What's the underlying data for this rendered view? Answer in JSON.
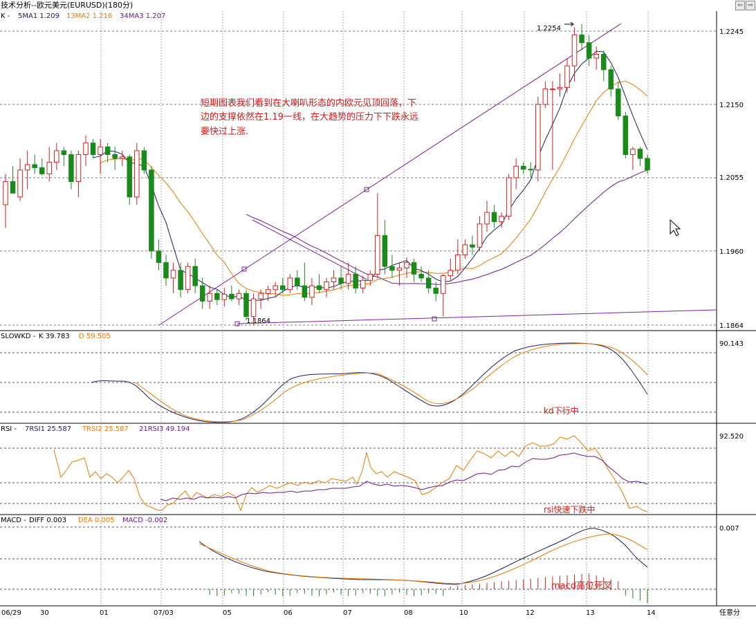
{
  "window": {
    "title": "技术分析--欧元美元(EURUSD)(180分)",
    "buttons": [
      "⇦",
      "⇨"
    ]
  },
  "colors": {
    "up": "#d42020",
    "down": "#1a8a1a",
    "ma5": "#1a2060",
    "ma13": "#ee7a00",
    "ma34": "#6a1a8a",
    "trend": "#8020a0",
    "annotation": "#d81818",
    "grid": "#888888",
    "axis": "#000000"
  },
  "main_panel": {
    "header": {
      "k": "K - ",
      "ma1": "5MA1  1.209",
      "ma2": "13MA2  1.216",
      "ma3": "34MA3  1.207"
    },
    "price_ticks": [
      "1.2245",
      "1.2150",
      "1.2055",
      "1.1960",
      "1.1864"
    ],
    "high_label": "1.2254",
    "low_label": "1.1864",
    "annotation": [
      "短期图表我们看到在大喇叭形态的内欧元见顶回落，下",
      "边的支撑依然在1.19一线，在大趋势的压力下下跌永远",
      "要快过上涨."
    ]
  },
  "kd_panel": {
    "header": {
      "name": "SLOWKD - ",
      "k": "K  39.783",
      "d": "D  59.505"
    },
    "tick": "90.143",
    "annotation": "kd下行中"
  },
  "rsi_panel": {
    "header": {
      "name": "RSI - ",
      "rsi1": "7RSI1  25.587",
      "rsi2": "TRSI2  25.587",
      "rsi3": "21RSI3  49.194"
    },
    "tick": "92.520",
    "annotation": "rsi快速下跌中"
  },
  "macd_panel": {
    "header": {
      "name": "MACD - ",
      "diff": "DIFF  0.003",
      "dea": "DEA  0.005",
      "macd": "MACD  -0.002"
    },
    "tick": "0.007",
    "annotation": "macd高位死叉"
  },
  "x_axis": {
    "labels": [
      "06/29",
      "30",
      "01",
      "07/03",
      "05",
      "06",
      "07",
      "08",
      "10",
      "12",
      "13",
      "14"
    ],
    "corner": "任意分"
  },
  "chart_data": {
    "type": "candlestick",
    "title": "技术分析--欧元美元(EURUSD)(180分)",
    "y_range": [
      1.1864,
      1.2254
    ],
    "candles": [
      {
        "o": 1.202,
        "h": 1.206,
        "l": 1.199,
        "c": 1.205
      },
      {
        "o": 1.205,
        "h": 1.207,
        "l": 1.2035,
        "c": 1.2035
      },
      {
        "o": 1.203,
        "h": 1.208,
        "l": 1.2025,
        "c": 1.2065
      },
      {
        "o": 1.2065,
        "h": 1.209,
        "l": 1.204,
        "c": 1.2072
      },
      {
        "o": 1.2072,
        "h": 1.2085,
        "l": 1.206,
        "c": 1.2068
      },
      {
        "o": 1.2068,
        "h": 1.208,
        "l": 1.2058,
        "c": 1.206
      },
      {
        "o": 1.206,
        "h": 1.2095,
        "l": 1.205,
        "c": 1.2075
      },
      {
        "o": 1.2075,
        "h": 1.21,
        "l": 1.2065,
        "c": 1.209
      },
      {
        "o": 1.209,
        "h": 1.2095,
        "l": 1.207,
        "c": 1.2085
      },
      {
        "o": 1.2085,
        "h": 1.209,
        "l": 1.204,
        "c": 1.205
      },
      {
        "o": 1.205,
        "h": 1.209,
        "l": 1.203,
        "c": 1.2085
      },
      {
        "o": 1.2085,
        "h": 1.211,
        "l": 1.207,
        "c": 1.21
      },
      {
        "o": 1.21,
        "h": 1.2105,
        "l": 1.208,
        "c": 1.2085
      },
      {
        "o": 1.2085,
        "h": 1.2105,
        "l": 1.206,
        "c": 1.2095
      },
      {
        "o": 1.2095,
        "h": 1.21,
        "l": 1.2075,
        "c": 1.2085
      },
      {
        "o": 1.2085,
        "h": 1.2095,
        "l": 1.2065,
        "c": 1.208
      },
      {
        "o": 1.208,
        "h": 1.209,
        "l": 1.207,
        "c": 1.2082
      },
      {
        "o": 1.2082,
        "h": 1.2085,
        "l": 1.202,
        "c": 1.203
      },
      {
        "o": 1.203,
        "h": 1.21,
        "l": 1.202,
        "c": 1.209
      },
      {
        "o": 1.209,
        "h": 1.2095,
        "l": 1.206,
        "c": 1.2065
      },
      {
        "o": 1.2065,
        "h": 1.207,
        "l": 1.195,
        "c": 1.196
      },
      {
        "o": 1.196,
        "h": 1.1975,
        "l": 1.1935,
        "c": 1.1945
      },
      {
        "o": 1.1945,
        "h": 1.1955,
        "l": 1.1915,
        "c": 1.1925
      },
      {
        "o": 1.1925,
        "h": 1.1945,
        "l": 1.1905,
        "c": 1.1935
      },
      {
        "o": 1.1935,
        "h": 1.1945,
        "l": 1.19,
        "c": 1.191
      },
      {
        "o": 1.191,
        "h": 1.1945,
        "l": 1.1905,
        "c": 1.194
      },
      {
        "o": 1.194,
        "h": 1.195,
        "l": 1.1905,
        "c": 1.1915
      },
      {
        "o": 1.1915,
        "h": 1.1925,
        "l": 1.1885,
        "c": 1.1895
      },
      {
        "o": 1.1895,
        "h": 1.1915,
        "l": 1.1885,
        "c": 1.1905
      },
      {
        "o": 1.1905,
        "h": 1.191,
        "l": 1.189,
        "c": 1.1897
      },
      {
        "o": 1.1897,
        "h": 1.1912,
        "l": 1.1888,
        "c": 1.1904
      },
      {
        "o": 1.1904,
        "h": 1.1915,
        "l": 1.1895,
        "c": 1.1898
      },
      {
        "o": 1.1898,
        "h": 1.191,
        "l": 1.189,
        "c": 1.1905
      },
      {
        "o": 1.1905,
        "h": 1.191,
        "l": 1.187,
        "c": 1.1875
      },
      {
        "o": 1.1875,
        "h": 1.1905,
        "l": 1.1864,
        "c": 1.1898
      },
      {
        "o": 1.1898,
        "h": 1.191,
        "l": 1.1885,
        "c": 1.1905
      },
      {
        "o": 1.1905,
        "h": 1.1915,
        "l": 1.1895,
        "c": 1.191
      },
      {
        "o": 1.191,
        "h": 1.192,
        "l": 1.19,
        "c": 1.1915
      },
      {
        "o": 1.1915,
        "h": 1.1925,
        "l": 1.1905,
        "c": 1.191
      },
      {
        "o": 1.191,
        "h": 1.193,
        "l": 1.1905,
        "c": 1.1925
      },
      {
        "o": 1.1925,
        "h": 1.1935,
        "l": 1.191,
        "c": 1.1915
      },
      {
        "o": 1.1915,
        "h": 1.1945,
        "l": 1.1895,
        "c": 1.19
      },
      {
        "o": 1.19,
        "h": 1.1925,
        "l": 1.189,
        "c": 1.1915
      },
      {
        "o": 1.1915,
        "h": 1.193,
        "l": 1.1905,
        "c": 1.191
      },
      {
        "o": 1.191,
        "h": 1.1925,
        "l": 1.19,
        "c": 1.192
      },
      {
        "o": 1.192,
        "h": 1.1935,
        "l": 1.191,
        "c": 1.1925
      },
      {
        "o": 1.1925,
        "h": 1.194,
        "l": 1.191,
        "c": 1.1918
      },
      {
        "o": 1.1918,
        "h": 1.1945,
        "l": 1.191,
        "c": 1.193
      },
      {
        "o": 1.193,
        "h": 1.194,
        "l": 1.1905,
        "c": 1.1912
      },
      {
        "o": 1.1912,
        "h": 1.1928,
        "l": 1.1905,
        "c": 1.1922
      },
      {
        "o": 1.1922,
        "h": 1.1935,
        "l": 1.1915,
        "c": 1.193
      },
      {
        "o": 1.193,
        "h": 1.2035,
        "l": 1.1925,
        "c": 1.198
      },
      {
        "o": 1.198,
        "h": 1.2,
        "l": 1.193,
        "c": 1.194
      },
      {
        "o": 1.194,
        "h": 1.1955,
        "l": 1.1925,
        "c": 1.1935
      },
      {
        "o": 1.1935,
        "h": 1.1945,
        "l": 1.1915,
        "c": 1.1938
      },
      {
        "o": 1.1938,
        "h": 1.1952,
        "l": 1.1925,
        "c": 1.1945
      },
      {
        "o": 1.1945,
        "h": 1.195,
        "l": 1.192,
        "c": 1.193
      },
      {
        "o": 1.193,
        "h": 1.194,
        "l": 1.192,
        "c": 1.1925
      },
      {
        "o": 1.1925,
        "h": 1.1935,
        "l": 1.1905,
        "c": 1.1912
      },
      {
        "o": 1.1912,
        "h": 1.192,
        "l": 1.1895,
        "c": 1.1905
      },
      {
        "o": 1.1905,
        "h": 1.193,
        "l": 1.1875,
        "c": 1.1928
      },
      {
        "o": 1.1928,
        "h": 1.195,
        "l": 1.1922,
        "c": 1.1935
      },
      {
        "o": 1.1935,
        "h": 1.1975,
        "l": 1.193,
        "c": 1.1955
      },
      {
        "o": 1.1955,
        "h": 1.1975,
        "l": 1.195,
        "c": 1.1968
      },
      {
        "o": 1.1968,
        "h": 1.198,
        "l": 1.1955,
        "c": 1.1965
      },
      {
        "o": 1.1965,
        "h": 1.2005,
        "l": 1.196,
        "c": 1.1995
      },
      {
        "o": 1.1995,
        "h": 1.2025,
        "l": 1.1985,
        "c": 1.201
      },
      {
        "o": 1.201,
        "h": 1.202,
        "l": 1.199,
        "c": 1.1998
      },
      {
        "o": 1.1998,
        "h": 1.201,
        "l": 1.199,
        "c": 1.2005
      },
      {
        "o": 1.2005,
        "h": 1.206,
        "l": 1.2,
        "c": 1.2055
      },
      {
        "o": 1.2055,
        "h": 1.208,
        "l": 1.204,
        "c": 1.207
      },
      {
        "o": 1.207,
        "h": 1.2075,
        "l": 1.206,
        "c": 1.2066
      },
      {
        "o": 1.2066,
        "h": 1.2075,
        "l": 1.2055,
        "c": 1.2065
      },
      {
        "o": 1.2065,
        "h": 1.216,
        "l": 1.205,
        "c": 1.215
      },
      {
        "o": 1.215,
        "h": 1.218,
        "l": 1.2145,
        "c": 1.217
      },
      {
        "o": 1.217,
        "h": 1.218,
        "l": 1.2065,
        "c": 1.217
      },
      {
        "o": 1.217,
        "h": 1.219,
        "l": 1.216,
        "c": 1.2172
      },
      {
        "o": 1.2172,
        "h": 1.221,
        "l": 1.2165,
        "c": 1.22
      },
      {
        "o": 1.22,
        "h": 1.225,
        "l": 1.218,
        "c": 1.224
      },
      {
        "o": 1.224,
        "h": 1.2254,
        "l": 1.222,
        "c": 1.223
      },
      {
        "o": 1.223,
        "h": 1.224,
        "l": 1.22,
        "c": 1.221
      },
      {
        "o": 1.221,
        "h": 1.2225,
        "l": 1.2195,
        "c": 1.2215
      },
      {
        "o": 1.2215,
        "h": 1.222,
        "l": 1.218,
        "c": 1.2195
      },
      {
        "o": 1.2195,
        "h": 1.22,
        "l": 1.216,
        "c": 1.217
      },
      {
        "o": 1.217,
        "h": 1.218,
        "l": 1.213,
        "c": 1.2135
      },
      {
        "o": 1.2135,
        "h": 1.214,
        "l": 1.208,
        "c": 1.2085
      },
      {
        "o": 1.2085,
        "h": 1.2095,
        "l": 1.2065,
        "c": 1.2092
      },
      {
        "o": 1.2092,
        "h": 1.2095,
        "l": 1.207,
        "c": 1.208
      },
      {
        "o": 1.208,
        "h": 1.2085,
        "l": 1.206,
        "c": 1.2065
      }
    ]
  }
}
